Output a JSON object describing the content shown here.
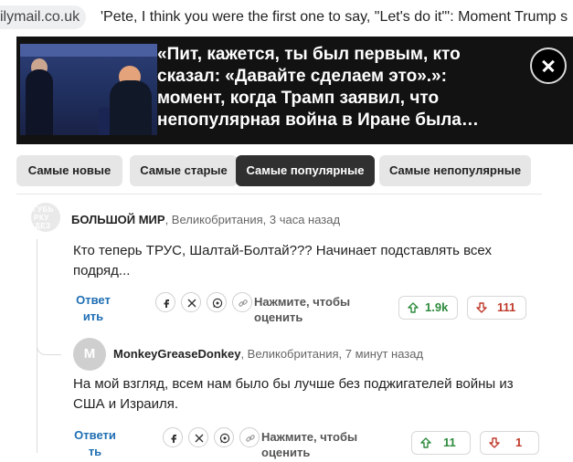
{
  "browser": {
    "url_fragment": "ilymail.co.uk",
    "tab_title": "'Pete, I think you were the first one to say, \"Let's do it\"': Moment Trump s"
  },
  "header": {
    "title": "«Пит, кажется, ты был первым, кто сказал: «Давайте сделаем это».»: момент, когда Трамп заявил, что непопулярная война в Иране была…"
  },
  "sort_tabs": [
    {
      "label": "Самые новые",
      "active": false
    },
    {
      "label": "Самые старые",
      "active": false
    },
    {
      "label": "Самые популярные",
      "active": true
    },
    {
      "label": "Самые непопулярные",
      "active": false
    }
  ],
  "comments": [
    {
      "username": "БОЛЬШОЙ МИР",
      "meta": ", Великобритания, 3 часа назад",
      "avatar_text": [
        "ГУБЬ",
        "РКУ",
        "ДЕЗ"
      ],
      "text": "Кто теперь ТРУС, Шалтай-Болтай??? Начинает подставлять всех подряд...",
      "reply_label_1": "Ответ",
      "reply_label_2": "ить",
      "rate_label_1": "Нажмите, чтобы",
      "rate_label_2": "оценить",
      "upvotes": "1.9k",
      "downvotes": "111"
    },
    {
      "username": "MonkeyGreaseDonkey",
      "meta": ", Великобритания, 7 минут назад",
      "avatar_letter": "M",
      "text": "На мой взгляд, всем нам было бы лучше без поджигателей войны из США и Израиля.",
      "reply_label_1": "Ответи",
      "reply_label_2": "ть",
      "rate_label_1": "Нажмите, чтобы",
      "rate_label_2": "оценить",
      "upvotes": "11",
      "downvotes": "1"
    }
  ],
  "colors": {
    "banner_bg": "#121212",
    "active_tab_bg": "#303030",
    "reply_link": "#1f6fb3",
    "upvote": "#2e8b3d",
    "downvote": "#c0392b"
  },
  "icons": [
    "close-icon",
    "facebook-icon",
    "x-icon",
    "whatsapp-icon",
    "link-icon",
    "arrow-up-icon",
    "arrow-down-icon"
  ]
}
